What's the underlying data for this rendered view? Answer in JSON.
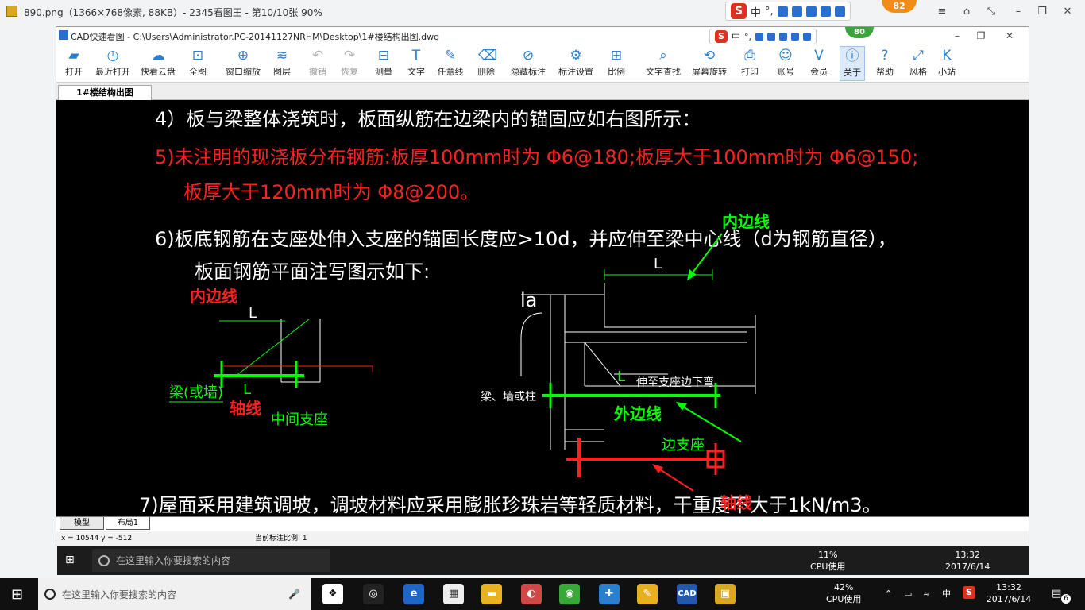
{
  "viewer": {
    "title": "890.png（1366×768像素, 88KB）- 2345看图王 - 第10/10张 90%",
    "badge": "82"
  },
  "ime": {
    "lang": "中",
    "punct": "°,"
  },
  "cad": {
    "title": "CAD快速看图 - C:\\Users\\Administrator.PC-20141127NRHM\\Desktop\\1#楼结构出图.dwg",
    "badge": "80",
    "toolbar": [
      {
        "id": "open",
        "label": "打开",
        "icon": "folder-icon",
        "glyph": "▰"
      },
      {
        "id": "recent",
        "label": "最近打开",
        "icon": "clock-icon",
        "glyph": "◷"
      },
      {
        "id": "cloud",
        "label": "快看云盘",
        "icon": "cloud-icon",
        "glyph": "☁"
      },
      {
        "id": "fit",
        "label": "全图",
        "icon": "fit-screen-icon",
        "glyph": "⊡"
      },
      {
        "id": "zoomwin",
        "label": "窗口缩放",
        "icon": "zoom-window-icon",
        "glyph": "⊕"
      },
      {
        "id": "layers",
        "label": "图层",
        "icon": "layers-icon",
        "glyph": "≋"
      },
      {
        "id": "undo",
        "label": "撤销",
        "icon": "undo-icon",
        "glyph": "↶",
        "disabled": true
      },
      {
        "id": "redo",
        "label": "恢复",
        "icon": "redo-icon",
        "glyph": "↷",
        "disabled": true
      },
      {
        "id": "measure",
        "label": "测量",
        "icon": "ruler-icon",
        "glyph": "⊟"
      },
      {
        "id": "text",
        "label": "文字",
        "icon": "text-icon",
        "glyph": "T"
      },
      {
        "id": "freeline",
        "label": "任意线",
        "icon": "pen-icon",
        "glyph": "✎"
      },
      {
        "id": "delete",
        "label": "删除",
        "icon": "eraser-icon",
        "glyph": "⌫"
      },
      {
        "id": "hide",
        "label": "隐藏标注",
        "icon": "eye-hidden-icon",
        "glyph": "⊘"
      },
      {
        "id": "markset",
        "label": "标注设置",
        "icon": "gear-icon",
        "glyph": "⚙"
      },
      {
        "id": "scale",
        "label": "比例",
        "icon": "scale-icon",
        "glyph": "⊞"
      },
      {
        "id": "find",
        "label": "文字查找",
        "icon": "search-icon",
        "glyph": "⌕"
      },
      {
        "id": "rotate",
        "label": "屏幕旋转",
        "icon": "rotate-icon",
        "glyph": "⟲"
      },
      {
        "id": "print",
        "label": "打印",
        "icon": "printer-icon",
        "glyph": "⎙"
      },
      {
        "id": "account",
        "label": "账号",
        "icon": "user-icon",
        "glyph": "☺"
      },
      {
        "id": "vip",
        "label": "会员",
        "icon": "vip-icon",
        "glyph": "V"
      },
      {
        "id": "about",
        "label": "关于",
        "icon": "info-icon",
        "glyph": "ⓘ",
        "active": true
      },
      {
        "id": "help",
        "label": "帮助",
        "icon": "help-icon",
        "glyph": "?"
      },
      {
        "id": "style",
        "label": "风格",
        "icon": "style-icon",
        "glyph": "⤢"
      },
      {
        "id": "site",
        "label": "小站",
        "icon": "k-logo-icon",
        "glyph": "K"
      }
    ],
    "tab": "1#楼结构出图",
    "drawing": {
      "line4": "4）板与梁整体浇筑时，板面纵筋在边梁内的锚固应如右图所示：",
      "line5a": "5)未注明的现浇板分布钢筋:板厚100mm时为 Φ6@180;板厚大于100mm时为 Φ6@150;",
      "line5b": "板厚大于120mm时为 Φ8@200。",
      "line6a": "6)板底钢筋在支座处伸入支座的锚固长度应>10d，并应伸至梁中心线（d为钢筋直径），",
      "line6b": "板面钢筋平面注写图示如下:",
      "line7": "7)屋面采用建筑调坡，调坡材料应采用膨胀珍珠岩等轻质材料，干重度不大于1kN/m3。",
      "inner_edge": "内边线",
      "axis": "轴线",
      "outer_edge": "外边线",
      "L": "L",
      "la": "la",
      "beam_wall": "梁(或墙)",
      "mid_support": "中间支座",
      "beam_wall_col": "梁、墙或柱",
      "bend_text": "伸至支座边下弯",
      "edge_support": "边支座"
    },
    "layouts": [
      "模型",
      "布局1"
    ],
    "coords": "x = 10544 y = -512",
    "scale_label": "当前标注比例: 1"
  },
  "taskbar": {
    "search_placeholder": "在这里输入你要搜索的内容",
    "cpu_pct": "42%",
    "cpu_label": "CPU使用",
    "time": "13:32",
    "date": "2017/6/14",
    "lang": "中",
    "notif": "6",
    "inner_cpu_pct": "11%"
  }
}
